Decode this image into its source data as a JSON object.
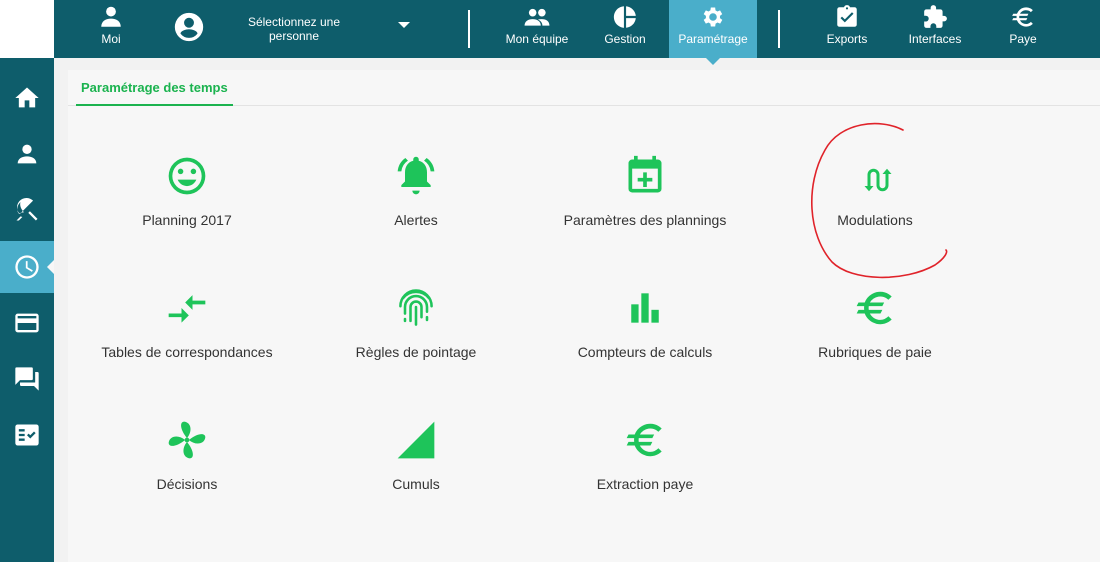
{
  "topbar": {
    "moi": "Moi",
    "person_select": "Sélectionnez une personne",
    "mon_equipe": "Mon équipe",
    "gestion": "Gestion",
    "parametrage": "Paramétrage",
    "exports": "Exports",
    "interfaces": "Interfaces",
    "paye": "Paye"
  },
  "tab": {
    "label": "Paramétrage des temps"
  },
  "tiles": [
    {
      "label": "Planning 2017",
      "icon": "smiley-icon"
    },
    {
      "label": "Alertes",
      "icon": "bell-ringing-icon"
    },
    {
      "label": "Paramètres des plannings",
      "icon": "calendar-plus-icon"
    },
    {
      "label": "Modulations",
      "icon": "swap-arrows-icon"
    },
    {
      "label": "Tables de correspondances",
      "icon": "compare-arrows-icon"
    },
    {
      "label": "Règles de pointage",
      "icon": "fingerprint-icon"
    },
    {
      "label": "Compteurs de calculs",
      "icon": "bar-chart-icon"
    },
    {
      "label": "Rubriques de paie",
      "icon": "euro-icon"
    },
    {
      "label": "Décisions",
      "icon": "fan-icon"
    },
    {
      "label": "Cumuls",
      "icon": "signal-triangle-icon"
    },
    {
      "label": "Extraction paye",
      "icon": "euro-icon"
    }
  ],
  "colors": {
    "primary": "#0e5d6b",
    "active": "#4aaeca",
    "accent": "#1ec45a",
    "annotation": "#e0232a"
  }
}
